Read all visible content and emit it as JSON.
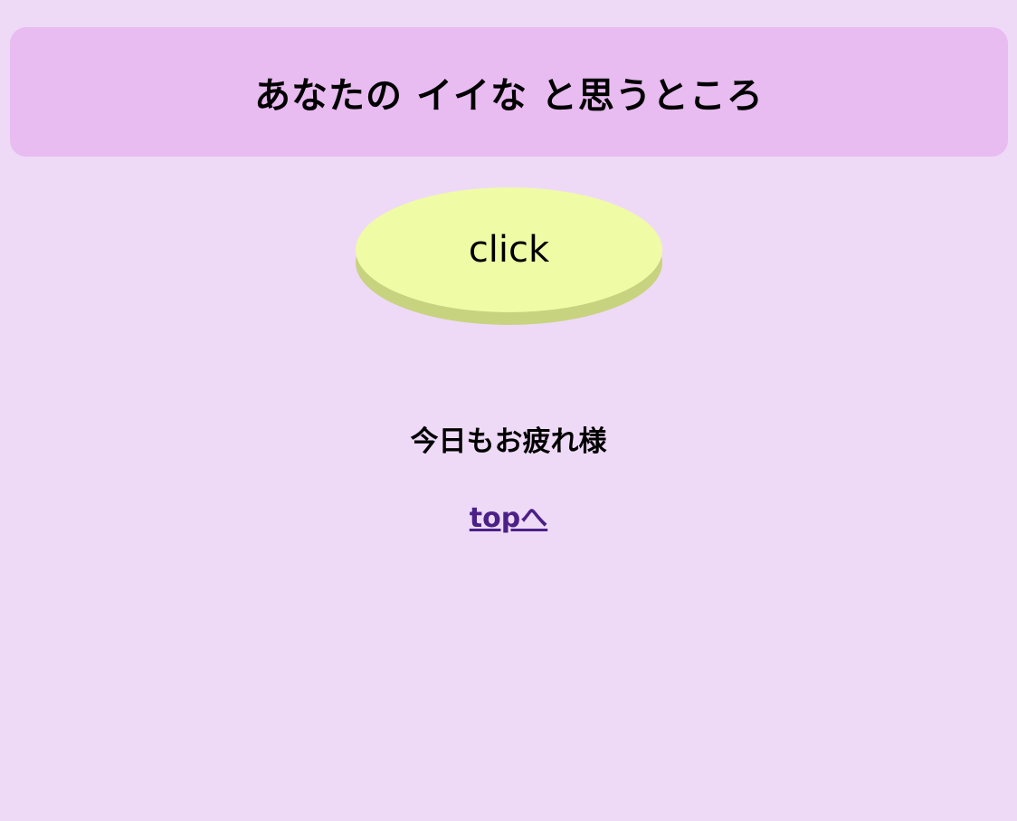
{
  "header": {
    "title": "あなたの イイな と思うところ"
  },
  "click_button": {
    "label": "click"
  },
  "message": {
    "text": "今日もお疲れ様"
  },
  "top_link": {
    "label": "topへ"
  },
  "colors": {
    "background": "#eedaf7",
    "header_background": "#e8bbf1",
    "button_face": "#f0fba6",
    "button_shadow": "#c8d380",
    "link": "#4b2187"
  }
}
